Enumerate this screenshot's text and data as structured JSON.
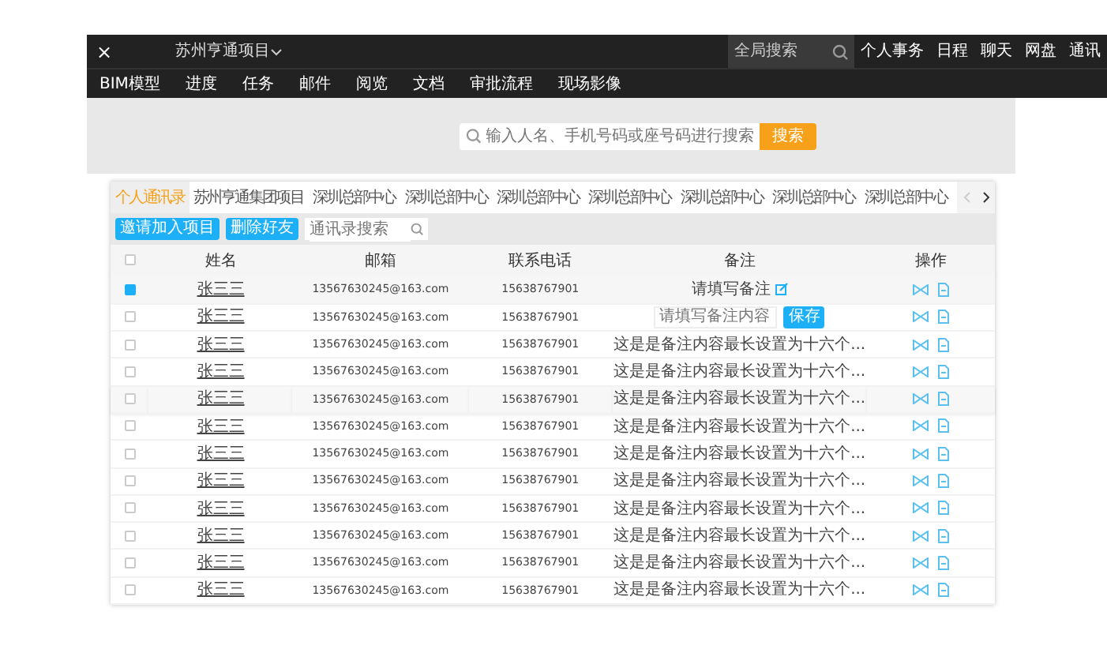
{
  "header": {
    "close_glyph": "×",
    "project": "苏州亨通项目",
    "search": {
      "placeholder": "全局搜索"
    },
    "links": [
      "个人事务",
      "日程",
      "聊天",
      "网盘",
      "通讯"
    ]
  },
  "nav": [
    "BIM模型",
    "进度",
    "任务",
    "邮件",
    "阅览",
    "文档",
    "审批流程",
    "现场影像"
  ],
  "people_search": {
    "placeholder": "输入人名、手机号码或座号码进行搜索",
    "button": "搜索"
  },
  "tabs": [
    {
      "label": "个人通讯录",
      "selected": true
    },
    {
      "label": "苏州亨通集团项目",
      "selected": false
    },
    {
      "label": "深圳总部中心",
      "selected": false
    },
    {
      "label": "深圳总部中心",
      "selected": false
    },
    {
      "label": "深圳总部中心",
      "selected": false
    },
    {
      "label": "深圳总部中心",
      "selected": false
    },
    {
      "label": "深圳总部中心",
      "selected": false
    },
    {
      "label": "深圳总部中心",
      "selected": false
    },
    {
      "label": "深圳总部中心",
      "selected": false
    }
  ],
  "toolbar": {
    "buttons": [
      "邀请加入项目",
      "删除好友"
    ],
    "search": {
      "placeholder": "通讯录搜索"
    }
  },
  "table": {
    "columns": [
      "姓名",
      "邮箱",
      "联系电话",
      "备注",
      "操作"
    ],
    "all_checked": false,
    "rows": [
      {
        "kind": "empty_remark",
        "selected": true,
        "hovered": false,
        "name": "张三三",
        "email": "13567630245@163.com",
        "phone": "15638767901",
        "remark": "请填写备注"
      },
      {
        "kind": "editing",
        "selected": false,
        "hovered": false,
        "name": "张三三",
        "email": "13567630245@163.com",
        "phone": "15638767901",
        "remark_placeholder": "请填写备注内容",
        "save": "保存"
      },
      {
        "kind": "remark",
        "selected": false,
        "hovered": false,
        "name": "张三三",
        "email": "13567630245@163.com",
        "phone": "15638767901",
        "remark": "这是是备注内容最长设置为十六个..."
      },
      {
        "kind": "remark",
        "selected": false,
        "hovered": false,
        "name": "张三三",
        "email": "13567630245@163.com",
        "phone": "15638767901",
        "remark": "这是是备注内容最长设置为十六个..."
      },
      {
        "kind": "remark",
        "selected": false,
        "hovered": true,
        "name": "张三三",
        "email": "13567630245@163.com",
        "phone": "15638767901",
        "remark": "这是是备注内容最长设置为十六个..."
      },
      {
        "kind": "remark",
        "selected": false,
        "hovered": false,
        "name": "张三三",
        "email": "13567630245@163.com",
        "phone": "15638767901",
        "remark": "这是是备注内容最长设置为十六个..."
      },
      {
        "kind": "remark",
        "selected": false,
        "hovered": false,
        "name": "张三三",
        "email": "13567630245@163.com",
        "phone": "15638767901",
        "remark": "这是是备注内容最长设置为十六个..."
      },
      {
        "kind": "remark",
        "selected": false,
        "hovered": false,
        "name": "张三三",
        "email": "13567630245@163.com",
        "phone": "15638767901",
        "remark": "这是是备注内容最长设置为十六个..."
      },
      {
        "kind": "remark",
        "selected": false,
        "hovered": false,
        "name": "张三三",
        "email": "13567630245@163.com",
        "phone": "15638767901",
        "remark": "这是是备注内容最长设置为十六个..."
      },
      {
        "kind": "remark",
        "selected": false,
        "hovered": false,
        "name": "张三三",
        "email": "13567630245@163.com",
        "phone": "15638767901",
        "remark": "这是是备注内容最长设置为十六个..."
      },
      {
        "kind": "remark",
        "selected": false,
        "hovered": false,
        "name": "张三三",
        "email": "13567630245@163.com",
        "phone": "15638767901",
        "remark": "这是是备注内容最长设置为十六个..."
      },
      {
        "kind": "remark",
        "selected": false,
        "hovered": false,
        "name": "张三三",
        "email": "13567630245@163.com",
        "phone": "15638767901",
        "remark": "这是是备注内容最长设置为十六个..."
      }
    ]
  }
}
